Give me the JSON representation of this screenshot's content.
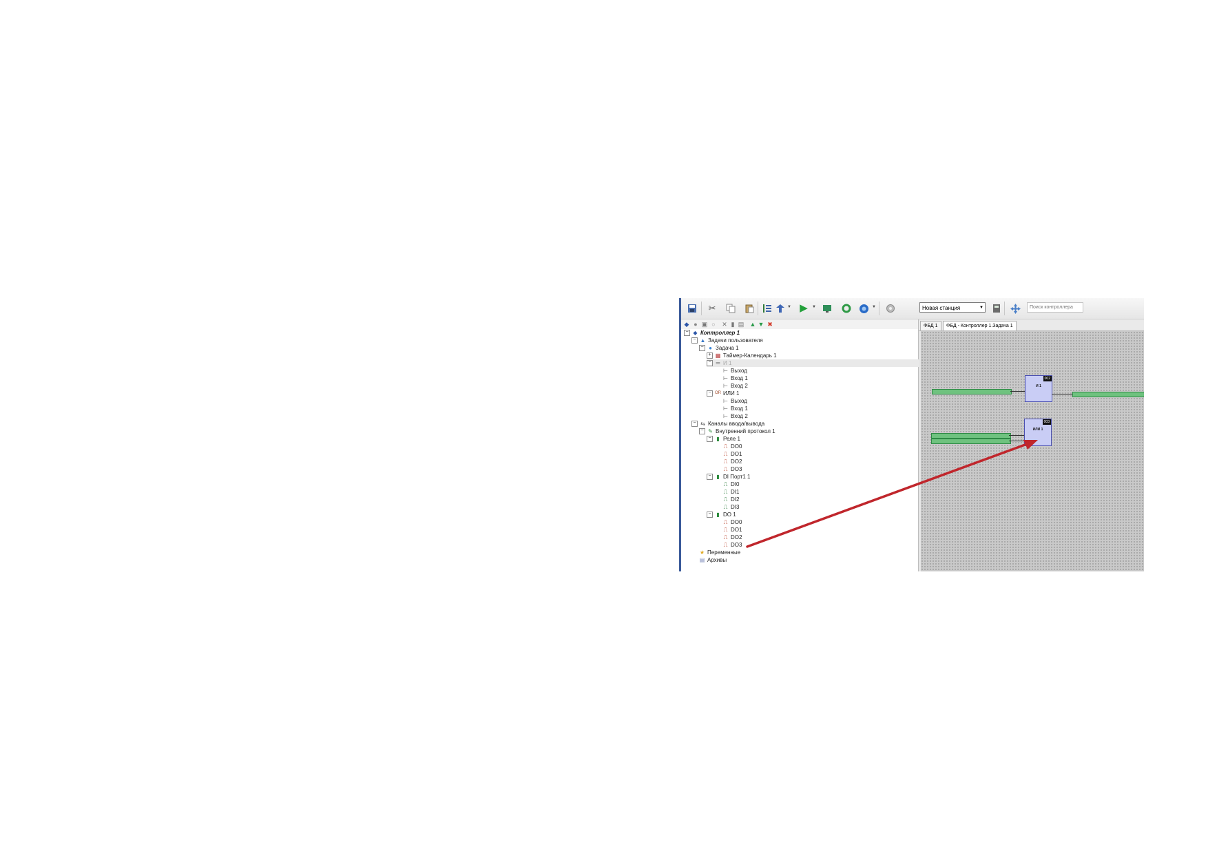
{
  "toolbar": {
    "station_value": "Новая станция",
    "search_placeholder": "Поиск контроллера"
  },
  "tree": {
    "items": [
      {
        "label": "Контроллер 1"
      },
      {
        "label": "Задачи пользователя"
      },
      {
        "label": "Задача 1"
      },
      {
        "label": "Таймер-Календарь 1"
      },
      {
        "label": "И 1"
      },
      {
        "label": "Выход"
      },
      {
        "label": "Вход 1"
      },
      {
        "label": "Вход 2"
      },
      {
        "label": "ИЛИ 1"
      },
      {
        "label": "Выход"
      },
      {
        "label": "Вход 1"
      },
      {
        "label": "Вход 2"
      },
      {
        "label": "Каналы ввода/вывода"
      },
      {
        "label": "Внутренний протокол 1"
      },
      {
        "label": "Реле 1"
      },
      {
        "label": "DO0"
      },
      {
        "label": "DO1"
      },
      {
        "label": "DO2"
      },
      {
        "label": "DO3"
      },
      {
        "label": "DI Порт1 1"
      },
      {
        "label": "DI0"
      },
      {
        "label": "DI1"
      },
      {
        "label": "DI2"
      },
      {
        "label": "DI3"
      },
      {
        "label": "DO 1"
      },
      {
        "label": "DO0"
      },
      {
        "label": "DO1"
      },
      {
        "label": "DO2"
      },
      {
        "label": "DO3"
      },
      {
        "label": "Переменные"
      },
      {
        "label": "Архивы"
      }
    ]
  },
  "editor": {
    "tabs": [
      {
        "label": "ФБД 1"
      },
      {
        "label": "ФБД - Контроллер 1.Задача 1"
      }
    ],
    "blocks": [
      {
        "number": "002",
        "name": "И 1"
      },
      {
        "number": "003",
        "name": "ИЛИ 1"
      }
    ]
  },
  "colors": {
    "arrow": "#c0262c",
    "var_tag": "#6fc27f",
    "block": "#c9cdf5"
  }
}
